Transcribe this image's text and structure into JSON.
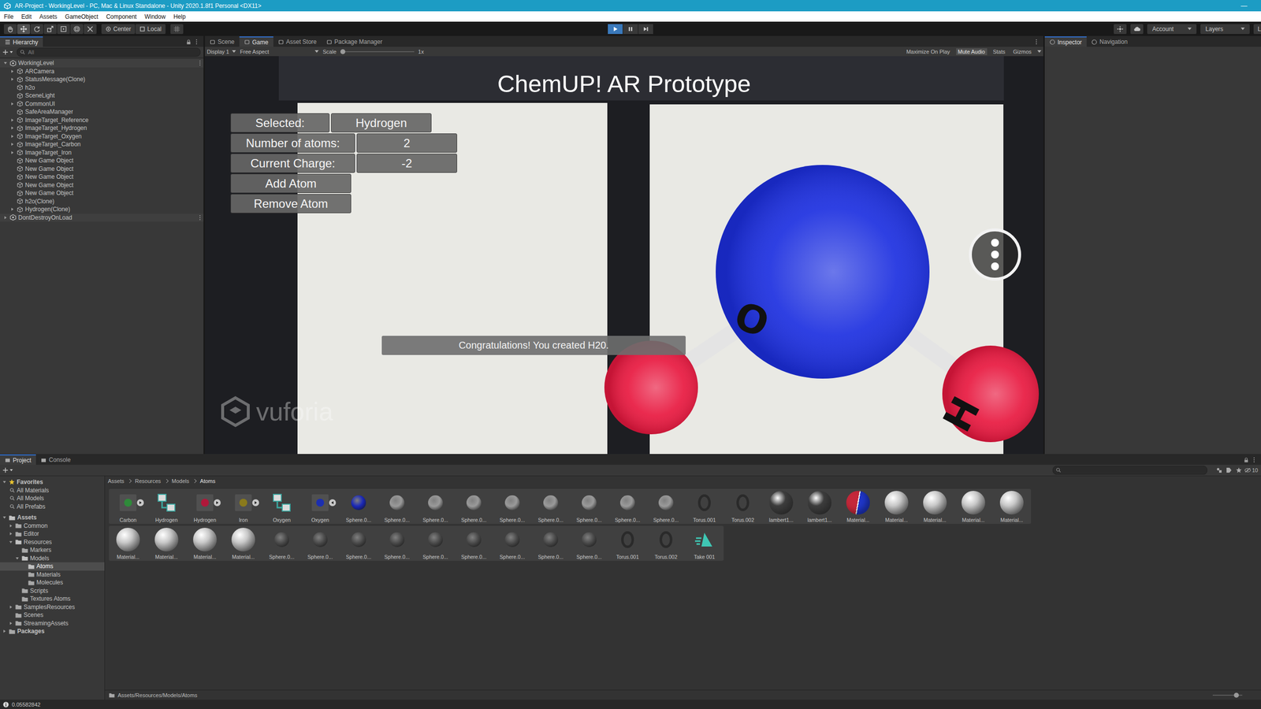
{
  "window": {
    "title": "AR-Project - WorkingLevel - PC, Mac & Linux Standalone - Unity 2020.1.8f1 Personal <DX11>",
    "controls": [
      "—"
    ]
  },
  "menu": [
    "File",
    "Edit",
    "Assets",
    "GameObject",
    "Component",
    "Window",
    "Help"
  ],
  "toolbar": {
    "pivot": "Center",
    "space": "Local",
    "playing": true,
    "paused": false,
    "account": "Account",
    "layers": "Layers",
    "layout": "L"
  },
  "hierarchy": {
    "title": "Hierarchy",
    "search_placeholder": "All",
    "items": [
      {
        "label": "WorkingLevel",
        "depth": 0,
        "kind": "scene",
        "expandable": true,
        "expanded": true
      },
      {
        "label": "ARCamera",
        "depth": 1,
        "kind": "object",
        "expandable": true,
        "expanded": false
      },
      {
        "label": "StatusMessage(Clone)",
        "depth": 1,
        "kind": "object",
        "expandable": true,
        "expanded": false
      },
      {
        "label": "h2o",
        "depth": 1,
        "kind": "object",
        "expandable": false,
        "expanded": false
      },
      {
        "label": "SceneLight",
        "depth": 1,
        "kind": "object",
        "expandable": false,
        "expanded": false
      },
      {
        "label": "CommonUI",
        "depth": 1,
        "kind": "object",
        "expandable": true,
        "expanded": false
      },
      {
        "label": "SafeAreaManager",
        "depth": 1,
        "kind": "object",
        "expandable": false,
        "expanded": false
      },
      {
        "label": "ImageTarget_Reference",
        "depth": 1,
        "kind": "object",
        "expandable": true,
        "expanded": false
      },
      {
        "label": "ImageTarget_Hydrogen",
        "depth": 1,
        "kind": "object",
        "expandable": true,
        "expanded": false
      },
      {
        "label": "ImageTarget_Oxygen",
        "depth": 1,
        "kind": "object",
        "expandable": true,
        "expanded": false
      },
      {
        "label": "ImageTarget_Carbon",
        "depth": 1,
        "kind": "object",
        "expandable": true,
        "expanded": false
      },
      {
        "label": "ImageTarget_Iron",
        "depth": 1,
        "kind": "object",
        "expandable": true,
        "expanded": false
      },
      {
        "label": "New Game Object",
        "depth": 1,
        "kind": "object",
        "expandable": false,
        "expanded": false
      },
      {
        "label": "New Game Object",
        "depth": 1,
        "kind": "object",
        "expandable": false,
        "expanded": false
      },
      {
        "label": "New Game Object",
        "depth": 1,
        "kind": "object",
        "expandable": false,
        "expanded": false
      },
      {
        "label": "New Game Object",
        "depth": 1,
        "kind": "object",
        "expandable": false,
        "expanded": false
      },
      {
        "label": "New Game Object",
        "depth": 1,
        "kind": "object",
        "expandable": false,
        "expanded": false
      },
      {
        "label": "h2o(Clone)",
        "depth": 1,
        "kind": "object",
        "expandable": false,
        "expanded": false
      },
      {
        "label": "Hydrogen(Clone)",
        "depth": 1,
        "kind": "object",
        "expandable": true,
        "expanded": false
      },
      {
        "label": "DontDestroyOnLoad",
        "depth": 0,
        "kind": "scene",
        "expandable": true,
        "expanded": false
      }
    ]
  },
  "game_view": {
    "tabs": [
      {
        "label": "Scene",
        "selected": false
      },
      {
        "label": "Game",
        "selected": true
      },
      {
        "label": "Asset Store",
        "selected": false
      },
      {
        "label": "Package Manager",
        "selected": false
      }
    ],
    "display": "Display 1",
    "aspect": "Free Aspect",
    "scale_label": "Scale",
    "scale_value": "1x",
    "scale_level": 0.0,
    "toggles": [
      {
        "label": "Maximize On Play",
        "on": false
      },
      {
        "label": "Mute Audio",
        "on": true
      },
      {
        "label": "Stats",
        "on": false
      },
      {
        "label": "Gizmos",
        "on": false
      }
    ]
  },
  "ar_ui": {
    "title": "ChemUP! AR Prototype",
    "rows": [
      {
        "label": "Selected:",
        "value": "Hydrogen"
      },
      {
        "label": "Number of atoms:",
        "value": "2"
      },
      {
        "label": "Current Charge:",
        "value": "-2"
      }
    ],
    "buttons": [
      "Add Atom",
      "Remove Atom"
    ],
    "message": "Congratulations! You created H20.",
    "watermark": "vuforia",
    "atoms": [
      {
        "element": "O",
        "label": "O",
        "color": "#1c2fe0"
      },
      {
        "element": "H",
        "color": "#e8183f"
      },
      {
        "element": "H",
        "label": "H",
        "color": "#e8183f"
      }
    ]
  },
  "inspector": {
    "tabs": [
      {
        "label": "Inspector",
        "selected": true
      },
      {
        "label": "Navigation",
        "selected": false
      }
    ]
  },
  "project": {
    "tabs": [
      {
        "label": "Project",
        "selected": true
      },
      {
        "label": "Console",
        "selected": false
      }
    ],
    "hidden_count": "10",
    "favorites": {
      "label": "Favorites",
      "items": [
        "All Materials",
        "All Models",
        "All Prefabs"
      ]
    },
    "tree": [
      {
        "label": "Assets",
        "depth": 0,
        "expandable": true,
        "expanded": true,
        "selected": false
      },
      {
        "label": "Common",
        "depth": 1,
        "expandable": true,
        "expanded": false,
        "selected": false
      },
      {
        "label": "Editor",
        "depth": 1,
        "expandable": true,
        "expanded": false,
        "selected": false
      },
      {
        "label": "Resources",
        "depth": 1,
        "expandable": true,
        "expanded": true,
        "selected": false
      },
      {
        "label": "Markers",
        "depth": 2,
        "expandable": false,
        "expanded": false,
        "selected": false
      },
      {
        "label": "Models",
        "depth": 2,
        "expandable": true,
        "expanded": true,
        "selected": false
      },
      {
        "label": "Atoms",
        "depth": 3,
        "expandable": false,
        "expanded": false,
        "selected": true
      },
      {
        "label": "Materials",
        "depth": 3,
        "expandable": false,
        "expanded": false,
        "selected": false
      },
      {
        "label": "Molecules",
        "depth": 3,
        "expandable": false,
        "expanded": false,
        "selected": false
      },
      {
        "label": "Scripts",
        "depth": 2,
        "expandable": false,
        "expanded": false,
        "selected": false
      },
      {
        "label": "Textures Atoms",
        "depth": 2,
        "expandable": false,
        "expanded": false,
        "selected": false
      },
      {
        "label": "SamplesResources",
        "depth": 1,
        "expandable": true,
        "expanded": false,
        "selected": false
      },
      {
        "label": "Scenes",
        "depth": 1,
        "expandable": false,
        "expanded": false,
        "selected": false
      },
      {
        "label": "StreamingAssets",
        "depth": 1,
        "expandable": true,
        "expanded": false,
        "selected": false
      },
      {
        "label": "Packages",
        "depth": 0,
        "expandable": true,
        "expanded": false,
        "selected": false
      }
    ],
    "breadcrumb": [
      "Assets",
      "Resources",
      "Models",
      "Atoms"
    ],
    "grid_rows": [
      [
        {
          "label": "Carbon",
          "kind": "prefab",
          "color": "#2f8a3a",
          "expandable": true,
          "expanded": false
        },
        {
          "label": "Hydrogen",
          "kind": "model",
          "color": "#3aa7a0",
          "expandable": false,
          "expanded": false
        },
        {
          "label": "Hydrogen",
          "kind": "prefab",
          "color": "#b0183a",
          "expandable": true,
          "expanded": false
        },
        {
          "label": "Iron",
          "kind": "prefab",
          "color": "#8a7a1c",
          "expandable": true,
          "expanded": false
        },
        {
          "label": "Oxygen",
          "kind": "model",
          "color": "#3aa7a0",
          "expandable": false,
          "expanded": false
        },
        {
          "label": "Oxygen",
          "kind": "prefab",
          "color": "#1c2fb0",
          "expandable": true,
          "expanded": true
        },
        {
          "label": "Sphere.0...",
          "kind": "sphere",
          "color": "#1a28b8",
          "expandable": false,
          "expanded": false
        },
        {
          "label": "Sphere.0...",
          "kind": "sphere",
          "color": "#9a9a9a",
          "expandable": false,
          "expanded": false
        },
        {
          "label": "Sphere.0...",
          "kind": "sphere",
          "color": "#9a9a9a",
          "expandable": false,
          "expanded": false
        },
        {
          "label": "Sphere.0...",
          "kind": "sphere",
          "color": "#9a9a9a",
          "expandable": false,
          "expanded": false
        },
        {
          "label": "Sphere.0...",
          "kind": "sphere",
          "color": "#9a9a9a",
          "expandable": false,
          "expanded": false
        },
        {
          "label": "Sphere.0...",
          "kind": "sphere",
          "color": "#9a9a9a",
          "expandable": false,
          "expanded": false
        },
        {
          "label": "Sphere.0...",
          "kind": "sphere",
          "color": "#9a9a9a",
          "expandable": false,
          "expanded": false
        },
        {
          "label": "Sphere.0...",
          "kind": "sphere",
          "color": "#9a9a9a",
          "expandable": false,
          "expanded": false
        },
        {
          "label": "Sphere.0...",
          "kind": "sphere",
          "color": "#9a9a9a",
          "expandable": false,
          "expanded": false
        },
        {
          "label": "Torus.001",
          "kind": "torus",
          "color": "#2a2a2a",
          "expandable": false,
          "expanded": false
        },
        {
          "label": "Torus.002",
          "kind": "torus",
          "color": "#2a2a2a",
          "expandable": false,
          "expanded": false
        },
        {
          "label": "lambert1...",
          "kind": "material",
          "color": "#3c3c3c",
          "expandable": false,
          "expanded": false
        },
        {
          "label": "lambert1...",
          "kind": "material",
          "color": "#3c3c3c",
          "expandable": false,
          "expanded": false
        },
        {
          "label": "Material...",
          "kind": "split-material",
          "color": "#c4283a",
          "expandable": false,
          "expanded": false
        },
        {
          "label": "Material...",
          "kind": "material",
          "color": "#c8c8c8",
          "expandable": false,
          "expanded": false
        },
        {
          "label": "Material...",
          "kind": "material",
          "color": "#c8c8c8",
          "expandable": false,
          "expanded": false
        },
        {
          "label": "Material...",
          "kind": "material",
          "color": "#c8c8c8",
          "expandable": false,
          "expanded": false
        },
        {
          "label": "Material...",
          "kind": "material",
          "color": "#c8c8c8",
          "expandable": false,
          "expanded": false
        }
      ],
      [
        {
          "label": "Material...",
          "kind": "material",
          "color": "#c8c8c8",
          "expandable": false,
          "expanded": false
        },
        {
          "label": "Material...",
          "kind": "material",
          "color": "#c8c8c8",
          "expandable": false,
          "expanded": false
        },
        {
          "label": "Material...",
          "kind": "material",
          "color": "#c8c8c8",
          "expandable": false,
          "expanded": false
        },
        {
          "label": "Material...",
          "kind": "material",
          "color": "#c8c8c8",
          "expandable": false,
          "expanded": false
        },
        {
          "label": "Sphere.0...",
          "kind": "sphere",
          "color": "#4a4a4a",
          "expandable": false,
          "expanded": false
        },
        {
          "label": "Sphere.0...",
          "kind": "sphere",
          "color": "#4a4a4a",
          "expandable": false,
          "expanded": false
        },
        {
          "label": "Sphere.0...",
          "kind": "sphere",
          "color": "#4a4a4a",
          "expandable": false,
          "expanded": false
        },
        {
          "label": "Sphere.0...",
          "kind": "sphere",
          "color": "#4a4a4a",
          "expandable": false,
          "expanded": false
        },
        {
          "label": "Sphere.0...",
          "kind": "sphere",
          "color": "#4a4a4a",
          "expandable": false,
          "expanded": false
        },
        {
          "label": "Sphere.0...",
          "kind": "sphere",
          "color": "#4a4a4a",
          "expandable": false,
          "expanded": false
        },
        {
          "label": "Sphere.0...",
          "kind": "sphere",
          "color": "#4a4a4a",
          "expandable": false,
          "expanded": false
        },
        {
          "label": "Sphere.0...",
          "kind": "sphere",
          "color": "#4a4a4a",
          "expandable": false,
          "expanded": false
        },
        {
          "label": "Sphere.0...",
          "kind": "sphere",
          "color": "#4a4a4a",
          "expandable": false,
          "expanded": false
        },
        {
          "label": "Torus.001",
          "kind": "torus",
          "color": "#2a2a2a",
          "expandable": false,
          "expanded": false
        },
        {
          "label": "Torus.002",
          "kind": "torus",
          "color": "#2a2a2a",
          "expandable": false,
          "expanded": false
        },
        {
          "label": "Take 001",
          "kind": "animation",
          "color": "#3fc7b4",
          "expandable": false,
          "expanded": false
        }
      ]
    ],
    "path": "Assets/Resources/Models/Atoms",
    "zoom_level": 0.72
  },
  "status_bar": {
    "message": "0.05582842"
  }
}
